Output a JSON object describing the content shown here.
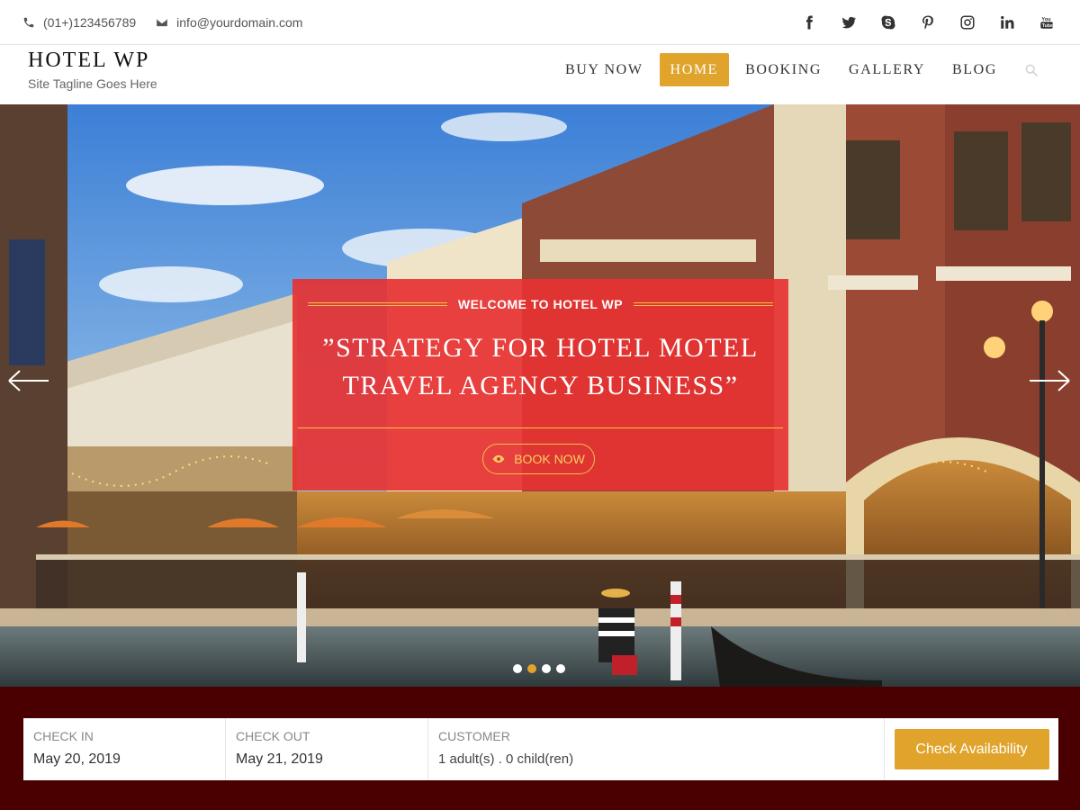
{
  "topbar": {
    "phone": "(01+)123456789",
    "email": "info@yourdomain.com",
    "phone_icon": "phone-icon",
    "email_icon": "envelope-icon",
    "social": [
      "facebook-icon",
      "twitter-icon",
      "skype-icon",
      "pinterest-icon",
      "instagram-icon",
      "linkedin-icon",
      "youtube-icon"
    ]
  },
  "header": {
    "site_name": "HOTEL WP",
    "tagline": "Site Tagline Goes Here",
    "nav": [
      {
        "label": "BUY NOW",
        "active": false
      },
      {
        "label": "HOME",
        "active": true
      },
      {
        "label": "BOOKING",
        "active": false
      },
      {
        "label": "GALLERY",
        "active": false
      },
      {
        "label": "BLOG",
        "active": false
      }
    ],
    "search_icon": "search-icon"
  },
  "hero": {
    "eyebrow": "WELCOME TO HOTEL WP",
    "heading": "”STRATEGY FOR HOTEL MOTEL TRAVEL AGENCY BUSINESS”",
    "button_label": "BOOK NOW",
    "button_icon": "eye-icon",
    "slides_count": 4,
    "active_slide": 2,
    "accent_color": "#e63232"
  },
  "booking": {
    "check_in_label": "CHECK IN",
    "check_in_value": "May 20, 2019",
    "check_out_label": "CHECK OUT",
    "check_out_value": "May 21, 2019",
    "customer_label": "CUSTOMER",
    "customer_value": "1 adult(s) . 0 child(ren)",
    "submit_label": "Check Availability",
    "button_color": "#e0a42c",
    "background_color": "#4a0000"
  }
}
